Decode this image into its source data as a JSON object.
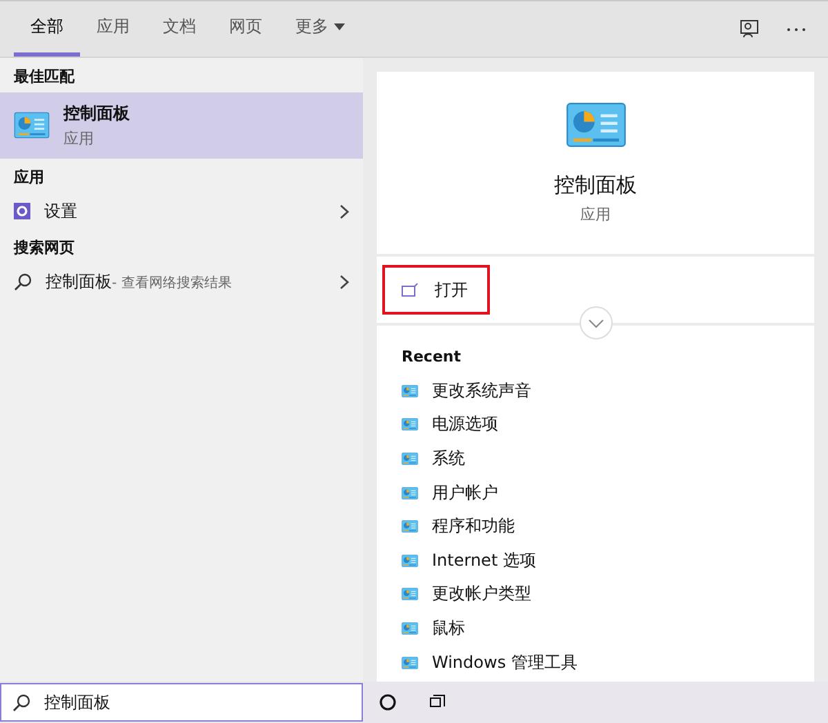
{
  "tabs": [
    {
      "label": "全部",
      "selected": true
    },
    {
      "label": "应用",
      "selected": false
    },
    {
      "label": "文档",
      "selected": false
    },
    {
      "label": "网页",
      "selected": false
    },
    {
      "label": "更多",
      "selected": false,
      "kind": "dropdown"
    }
  ],
  "left": {
    "sections": [
      {
        "heading": "最佳匹配",
        "items": [
          {
            "kind": "best",
            "title": "控制面板",
            "subtitle": "应用",
            "selected": true
          }
        ]
      },
      {
        "heading": "应用",
        "items": [
          {
            "kind": "app",
            "title": "设置",
            "selected": false
          }
        ]
      },
      {
        "heading": "搜索网页",
        "items": [
          {
            "kind": "web",
            "title": "控制面板",
            "hint": " - 查看网络搜索结果",
            "selected": false
          }
        ]
      }
    ]
  },
  "detail": {
    "title": "控制面板",
    "subtitle": "应用",
    "actions": [
      {
        "label": "打开",
        "highlighted": true
      }
    ],
    "recent_heading": "Recent",
    "recent": [
      "更改系统声音",
      "电源选项",
      "系统",
      "用户帐户",
      "程序和功能",
      "Internet 选项",
      "更改帐户类型",
      "鼠标",
      "Windows 管理工具"
    ]
  },
  "search": {
    "value": "控制面板"
  }
}
